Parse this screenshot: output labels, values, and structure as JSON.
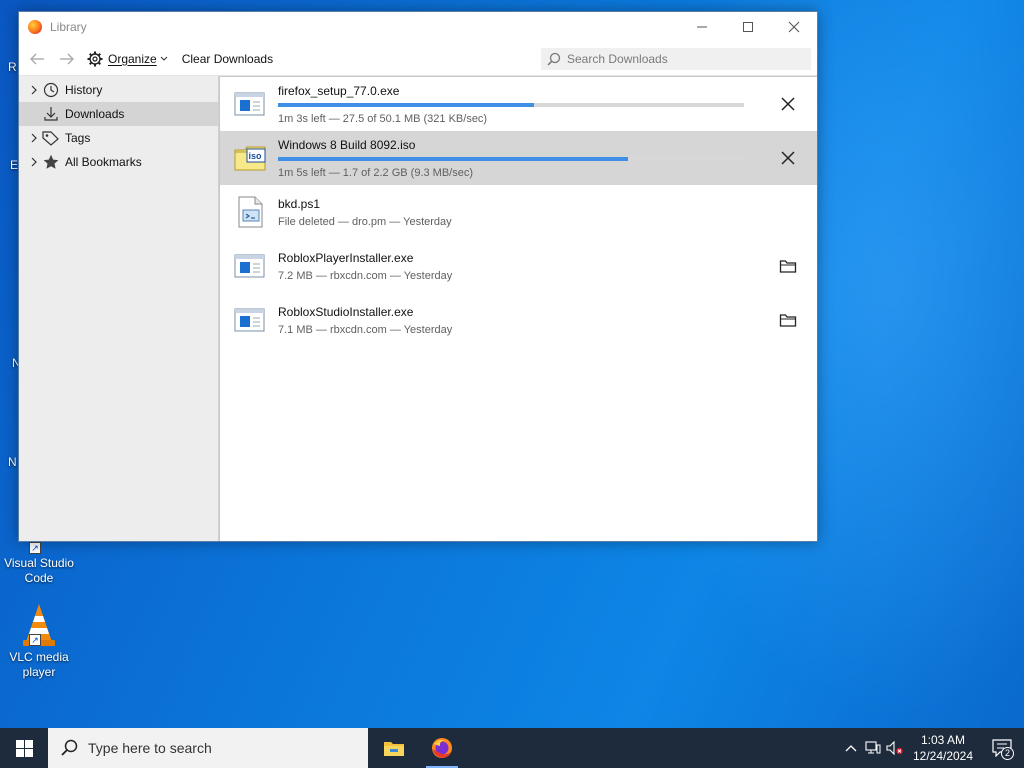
{
  "window": {
    "title": "Library"
  },
  "toolbar": {
    "organize_label": "Organize",
    "clear_label": "Clear Downloads",
    "search_placeholder": "Search Downloads"
  },
  "sidebar": {
    "items": [
      {
        "label": "History",
        "icon": "clock-icon",
        "expandable": true,
        "selected": false
      },
      {
        "label": "Downloads",
        "icon": "download-icon",
        "expandable": false,
        "selected": true
      },
      {
        "label": "Tags",
        "icon": "tag-icon",
        "expandable": true,
        "selected": false
      },
      {
        "label": "All Bookmarks",
        "icon": "star-icon",
        "expandable": true,
        "selected": false
      }
    ]
  },
  "downloads": [
    {
      "name": "firefox_setup_77.0.exe",
      "status": "1m 3s left — 27.5 of 50.1 MB (321 KB/sec)",
      "progress": 0.55,
      "icon": "exe-file-icon",
      "action": "cancel",
      "selected": false
    },
    {
      "name": "Windows 8 Build 8092.iso",
      "status": "1m 5s left — 1.7 of 2.2 GB (9.3 MB/sec)",
      "progress": 0.75,
      "icon": "iso-file-icon",
      "action": "cancel",
      "selected": true
    },
    {
      "name": "bkd.ps1",
      "status": "File deleted — dro.pm — Yesterday",
      "progress": null,
      "icon": "script-file-icon",
      "action": "none",
      "selected": false
    },
    {
      "name": "RobloxPlayerInstaller.exe",
      "status": "7.2 MB — rbxcdn.com — Yesterday",
      "progress": null,
      "icon": "exe-file-icon",
      "action": "folder",
      "selected": false
    },
    {
      "name": "RobloxStudioInstaller.exe",
      "status": "7.1 MB — rbxcdn.com — Yesterday",
      "progress": null,
      "icon": "exe-file-icon",
      "action": "folder",
      "selected": false
    }
  ],
  "desktop": {
    "icons": [
      {
        "label": "Visual Studio Code",
        "icon": "vscode-icon"
      },
      {
        "label": "VLC media player",
        "icon": "vlc-icon"
      }
    ],
    "edge_letters": [
      "R",
      "E",
      "N",
      "N"
    ]
  },
  "taskbar": {
    "search_placeholder": "Type here to search",
    "time": "1:03 AM",
    "date": "12/24/2024",
    "notification_count": "2"
  },
  "colors": {
    "accent": "#3f8ee8",
    "selected_row": "#d6d6d6",
    "sidebar_bg": "#ededed",
    "taskbar": "#1e2b3c"
  }
}
